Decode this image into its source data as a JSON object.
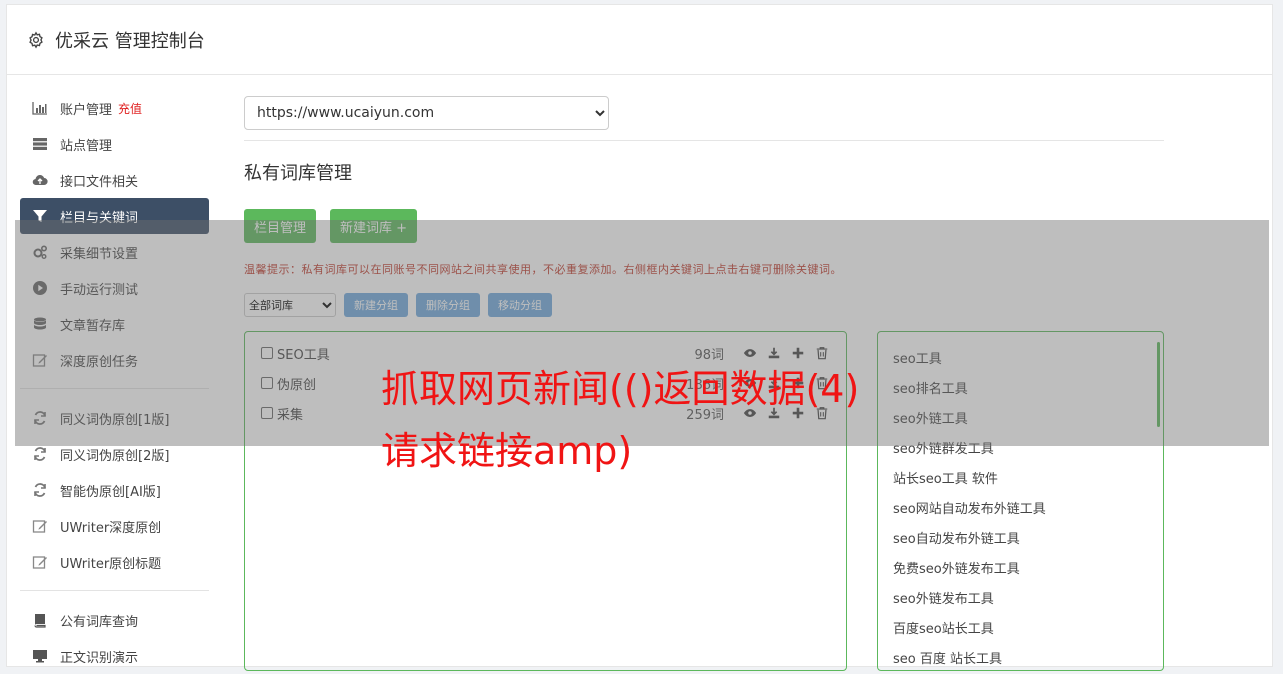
{
  "header": {
    "title": "优采云 管理控制台",
    "icon": "gear-icon"
  },
  "sidebar": {
    "group1": [
      {
        "label": "账户管理",
        "badge": "充值",
        "icon": "bar-chart-icon"
      },
      {
        "label": "站点管理",
        "icon": "server-icon"
      },
      {
        "label": "接口文件相关",
        "icon": "cloud-upload-icon"
      },
      {
        "label": "栏目与关键词",
        "icon": "filter-icon",
        "active": true
      },
      {
        "label": "采集细节设置",
        "icon": "cogs-icon"
      },
      {
        "label": "手动运行测试",
        "icon": "play-circle-icon"
      },
      {
        "label": "文章暂存库",
        "icon": "database-icon"
      },
      {
        "label": "深度原创任务",
        "icon": "edit-icon"
      }
    ],
    "group2": [
      {
        "label": "同义词伪原创[1版]",
        "icon": "refresh-icon"
      },
      {
        "label": "同义词伪原创[2版]",
        "icon": "refresh-icon"
      },
      {
        "label": "智能伪原创[AI版]",
        "icon": "refresh-icon"
      },
      {
        "label": "UWriter深度原创",
        "icon": "edit-icon"
      },
      {
        "label": "UWriter原创标题",
        "icon": "edit-icon"
      }
    ],
    "group3": [
      {
        "label": "公有词库查询",
        "icon": "book-icon"
      },
      {
        "label": "正文识别演示",
        "icon": "monitor-icon"
      }
    ]
  },
  "main": {
    "site_select": "https://www.ucaiyun.com",
    "page_title": "私有词库管理",
    "btn_column": "栏目管理",
    "btn_new_lib": "新建词库 +",
    "tip": "温馨提示：私有词库可以在同账号不同网站之间共享使用，不必重复添加。右侧框内关键词上点击右键可删除关键词。",
    "group_select": "全部词库",
    "btn_new_group": "新建分组",
    "btn_del_group": "删除分组",
    "btn_move_group": "移动分组",
    "libraries": [
      {
        "name": "SEO工具",
        "count": "98词"
      },
      {
        "name": "伪原创",
        "count": "186词"
      },
      {
        "name": "采集",
        "count": "259词"
      }
    ],
    "keywords": [
      "seo工具",
      "seo排名工具",
      "seo外链工具",
      "seo外链群发工具",
      "站长seo工具 软件",
      "seo网站自动发布外链工具",
      "seo自动发布外链工具",
      "免费seo外链发布工具",
      "seo外链发布工具",
      "百度seo站长工具",
      "seo 百度 站长工具"
    ]
  },
  "overlay_text": "抓取网页新闻(()返回数据(4)请求链接amp)",
  "colors": {
    "accent_green": "#5cb85c",
    "active_nav": "#3d4f66",
    "overlay_red": "#f01414"
  }
}
